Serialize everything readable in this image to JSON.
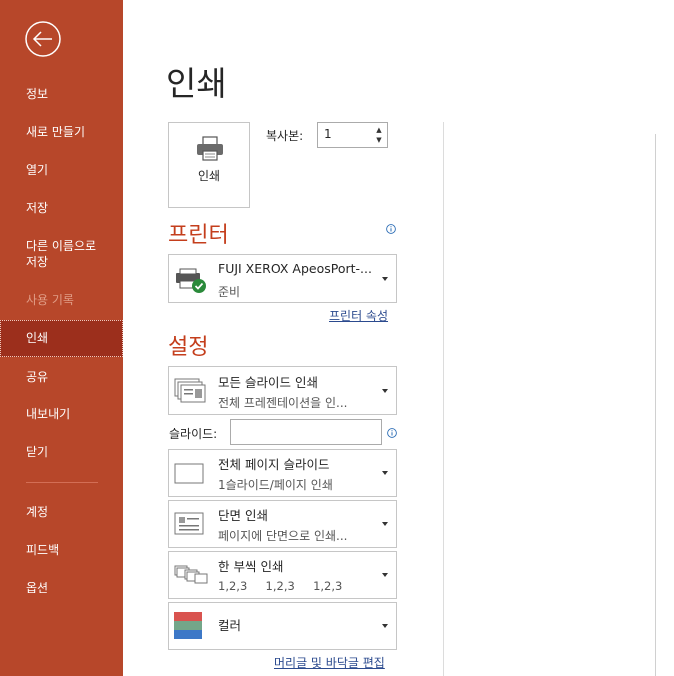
{
  "sidebar": {
    "back_label": "back",
    "items": [
      {
        "label": "정보"
      },
      {
        "label": "새로 만들기"
      },
      {
        "label": "열기"
      },
      {
        "label": "저장"
      },
      {
        "label": "다른 이름으로"
      },
      {
        "label": "저장"
      },
      {
        "label": "사용 기록"
      },
      {
        "label": "인쇄"
      },
      {
        "label": "공유"
      },
      {
        "label": "내보내기"
      },
      {
        "label": "닫기"
      },
      {
        "label": "계정"
      },
      {
        "label": "피드백"
      },
      {
        "label": "옵션"
      }
    ],
    "active_item": "인쇄",
    "disabled_item": "사용 기록"
  },
  "main": {
    "title": "인쇄",
    "print_button_label": "인쇄",
    "copies_label": "복사본:",
    "copies_value": "1",
    "printer_heading": "프린터",
    "printer": {
      "name": "FUJI XEROX ApeosPort-...",
      "status": "준비",
      "icon": "printer-ready-icon"
    },
    "printer_properties_link": "프린터 속성",
    "settings_heading": "설정",
    "slides_label": "슬라이드:",
    "slides_value": "",
    "settings": {
      "range": {
        "title": "모든 슬라이드 인쇄",
        "subtitle": "전체 프레젠테이션을 인..."
      },
      "layout": {
        "title": "전체 페이지 슬라이드",
        "subtitle": "1슬라이드/페이지 인쇄"
      },
      "sides": {
        "title": "단면 인쇄",
        "subtitle": "페이지에 단면으로 인쇄..."
      },
      "collate": {
        "title": "한 부씩 인쇄",
        "subtitle": "1,2,3     1,2,3     1,2,3"
      },
      "color": {
        "title": "컬러"
      }
    },
    "header_footer_link": "머리글 및 바닥글 편집"
  },
  "colors": {
    "accent": "#b7472a",
    "active": "#9c2f1c",
    "heading": "#c43e1c",
    "link": "#2b4a8e"
  }
}
